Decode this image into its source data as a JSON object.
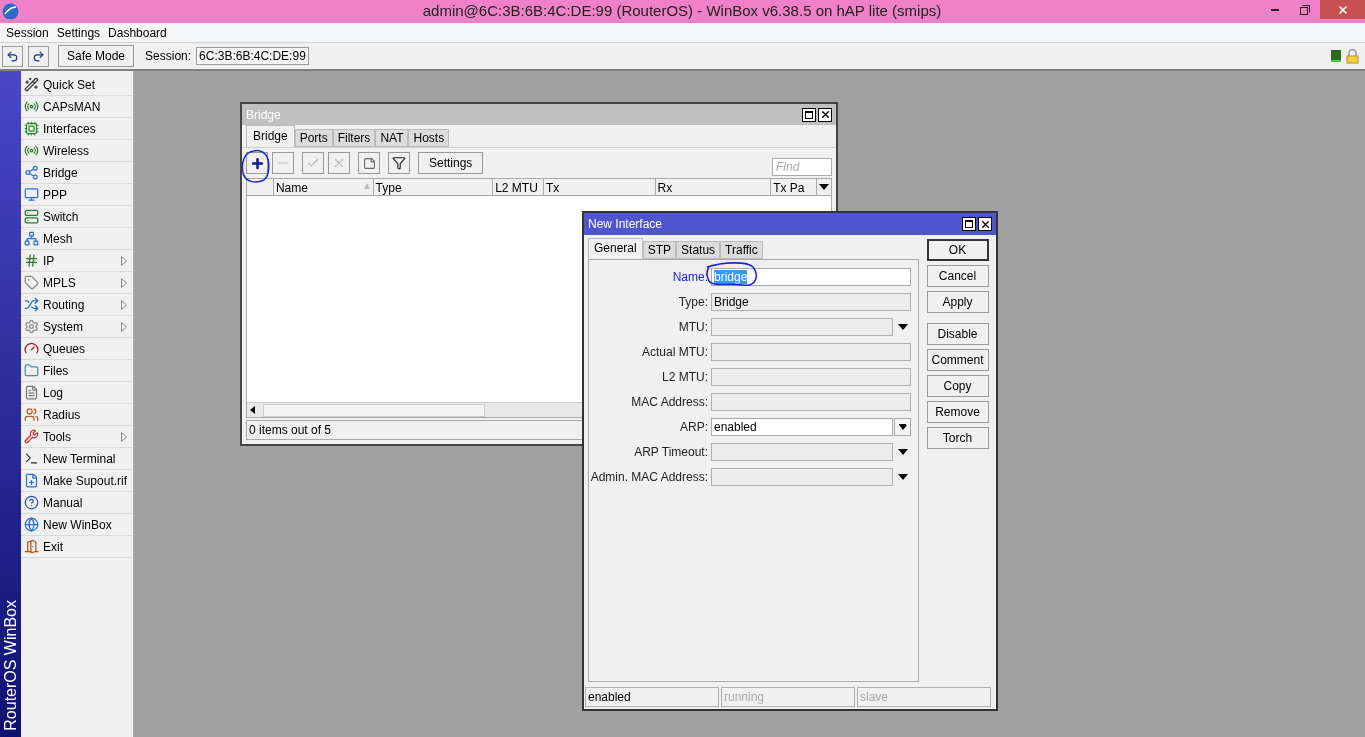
{
  "window": {
    "title": "admin@6C:3B:6B:4C:DE:99 (RouterOS) - WinBox v6.38.5 on hAP lite (smips)"
  },
  "menu": [
    "Session",
    "Settings",
    "Dashboard"
  ],
  "toolbar": {
    "safe_mode": "Safe Mode",
    "session_label": "Session:",
    "session_value": "6C:3B:6B:4C:DE:99"
  },
  "side_banner": "RouterOS WinBox",
  "sidebar": [
    {
      "label": "Quick Set",
      "submenu": false
    },
    {
      "label": "CAPsMAN",
      "submenu": false
    },
    {
      "label": "Interfaces",
      "submenu": false
    },
    {
      "label": "Wireless",
      "submenu": false
    },
    {
      "label": "Bridge",
      "submenu": false
    },
    {
      "label": "PPP",
      "submenu": false
    },
    {
      "label": "Switch",
      "submenu": false
    },
    {
      "label": "Mesh",
      "submenu": false
    },
    {
      "label": "IP",
      "submenu": true
    },
    {
      "label": "MPLS",
      "submenu": true
    },
    {
      "label": "Routing",
      "submenu": true
    },
    {
      "label": "System",
      "submenu": true
    },
    {
      "label": "Queues",
      "submenu": false
    },
    {
      "label": "Files",
      "submenu": false
    },
    {
      "label": "Log",
      "submenu": false
    },
    {
      "label": "Radius",
      "submenu": false
    },
    {
      "label": "Tools",
      "submenu": true
    },
    {
      "label": "New Terminal",
      "submenu": false
    },
    {
      "label": "Make Supout.rif",
      "submenu": false
    },
    {
      "label": "Manual",
      "submenu": false
    },
    {
      "label": "New WinBox",
      "submenu": false
    },
    {
      "label": "Exit",
      "submenu": false
    }
  ],
  "bridge_window": {
    "title": "Bridge",
    "tabs": [
      {
        "label": "Bridge",
        "selected": true
      },
      {
        "label": "Ports",
        "selected": false
      },
      {
        "label": "Filters",
        "selected": false
      },
      {
        "label": "NAT",
        "selected": false
      },
      {
        "label": "Hosts",
        "selected": false
      }
    ],
    "settings_button": "Settings",
    "find_placeholder": "Find",
    "columns": [
      "Name",
      "Type",
      "L2 MTU",
      "Tx",
      "Rx",
      "Tx Pa"
    ],
    "status": "0 items out of 5"
  },
  "new_interface": {
    "title": "New Interface",
    "tabs": [
      {
        "label": "General",
        "selected": true
      },
      {
        "label": "STP",
        "selected": false
      },
      {
        "label": "Status",
        "selected": false
      },
      {
        "label": "Traffic",
        "selected": false
      }
    ],
    "fields": [
      {
        "label": "Name:",
        "value": "bridge",
        "kind": "input",
        "focused": true
      },
      {
        "label": "Type:",
        "value": "Bridge",
        "kind": "readonly",
        "focused": false
      },
      {
        "label": "MTU:",
        "kind": "dropdown",
        "focused": false
      },
      {
        "label": "Actual MTU:",
        "kind": "readonly",
        "focused": false
      },
      {
        "label": "L2 MTU:",
        "kind": "readonly",
        "focused": false
      },
      {
        "label": "MAC Address:",
        "kind": "readonly",
        "focused": false
      },
      {
        "label": "ARP:",
        "value": "enabled",
        "kind": "select",
        "focused": false
      },
      {
        "label": "ARP Timeout:",
        "kind": "dropdown",
        "focused": false
      },
      {
        "label": "Admin. MAC Address:",
        "kind": "dropdown",
        "focused": false
      }
    ],
    "button_groups": [
      [
        {
          "label": "OK",
          "default": true
        },
        {
          "label": "Cancel",
          "default": false
        },
        {
          "label": "Apply",
          "default": false
        }
      ],
      [
        {
          "label": "Disable",
          "default": false
        },
        {
          "label": "Comment",
          "default": false
        },
        {
          "label": "Copy",
          "default": false
        },
        {
          "label": "Remove",
          "default": false
        },
        {
          "label": "Torch",
          "default": false
        }
      ]
    ],
    "status": [
      {
        "text": "enabled",
        "active": true
      },
      {
        "text": "running",
        "active": false
      },
      {
        "text": "slave",
        "active": false
      }
    ]
  }
}
